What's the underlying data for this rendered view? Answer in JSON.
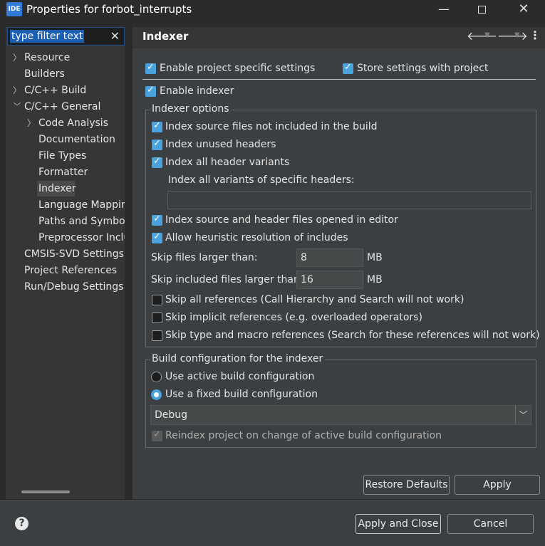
{
  "window": {
    "title": "Properties for forbot_interrupts",
    "logo": "IDE"
  },
  "filter": {
    "text": "type filter text"
  },
  "tree": [
    {
      "label": "Resource",
      "chevron": "right"
    },
    {
      "label": "Builders",
      "chevron": ""
    },
    {
      "label": "C/C++ Build",
      "chevron": "right"
    },
    {
      "label": "C/C++ General",
      "chevron": "down"
    },
    {
      "label": "Code Analysis",
      "chevron": "right"
    },
    {
      "label": "Documentation",
      "chevron": ""
    },
    {
      "label": "File Types",
      "chevron": ""
    },
    {
      "label": "Formatter",
      "chevron": ""
    },
    {
      "label": "Indexer",
      "chevron": "",
      "selected": true
    },
    {
      "label": "Language Mapping",
      "chevron": ""
    },
    {
      "label": "Paths and Symbols",
      "chevron": ""
    },
    {
      "label": "Preprocessor Inclu",
      "chevron": ""
    },
    {
      "label": "CMSIS-SVD Settings",
      "chevron": ""
    },
    {
      "label": "Project References",
      "chevron": ""
    },
    {
      "label": "Run/Debug Settings",
      "chevron": ""
    }
  ],
  "page": {
    "title": "Indexer",
    "enable_project_specific": "Enable project specific settings",
    "store_with_project": "Store settings with project",
    "enable_indexer": "Enable indexer",
    "options_legend": "Indexer options",
    "opt_not_in_build": "Index source files not included in the build",
    "opt_unused_headers": "Index unused headers",
    "opt_all_header_variants": "Index all header variants",
    "opt_specific_headers_label": "Index all variants of specific headers:",
    "opt_specific_headers_value": "",
    "opt_opened_in_editor": "Index source and header files opened in editor",
    "opt_heuristic": "Allow heuristic resolution of includes",
    "skip_larger_label": "Skip files larger than:",
    "skip_larger_value": "8",
    "skip_larger_unit": "MB",
    "skip_included_label": "Skip included files larger than:",
    "skip_included_value": "16",
    "skip_included_unit": "MB",
    "skip_all_refs": "Skip all references (Call Hierarchy and Search will not work)",
    "skip_implicit_refs": "Skip implicit references (e.g. overloaded operators)",
    "skip_type_macro_refs": "Skip type and macro references (Search for these references will not work)",
    "build_legend": "Build configuration for the indexer",
    "use_active": "Use active build configuration",
    "use_fixed": "Use a fixed build configuration",
    "fixed_config_value": "Debug",
    "reindex_on_change": "Reindex project on change of active build configuration"
  },
  "buttons": {
    "restore_defaults": "Restore Defaults",
    "apply": "Apply",
    "apply_and_close": "Apply and Close",
    "cancel": "Cancel"
  },
  "colors": {
    "accent": "#4aa3df",
    "selection": "#1a5fb4"
  }
}
